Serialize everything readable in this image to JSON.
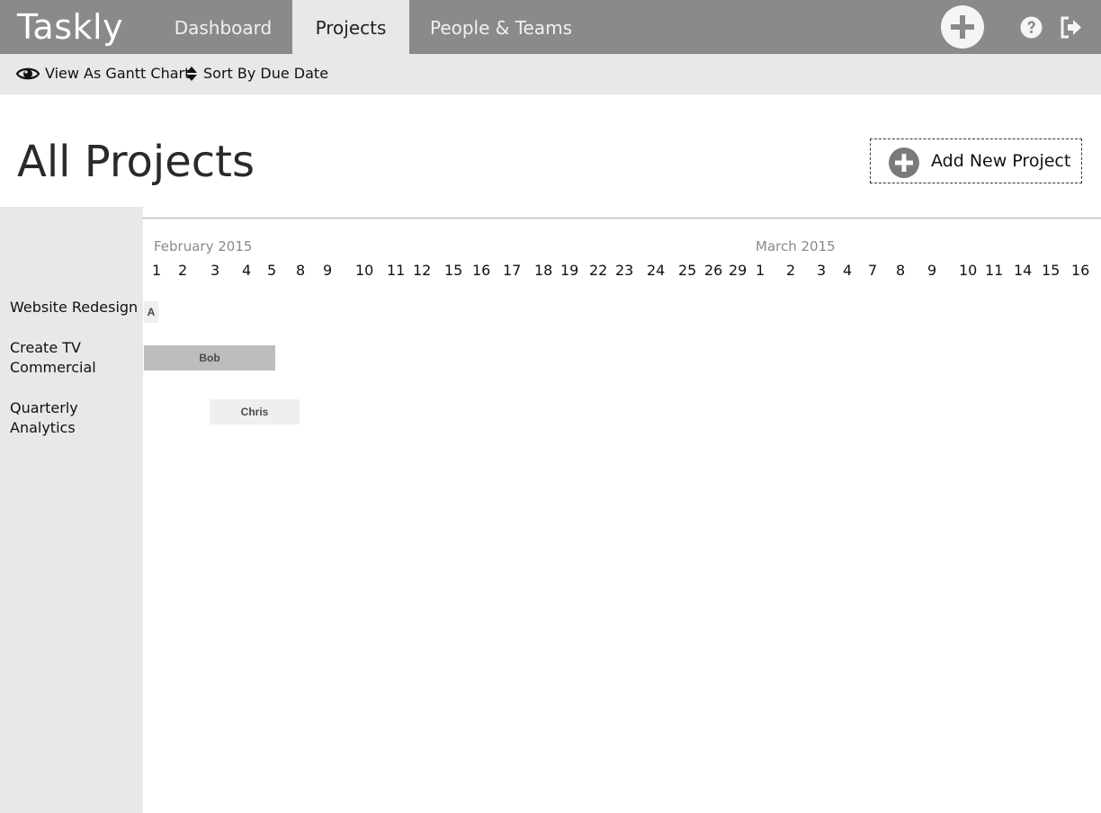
{
  "app": {
    "brand": "Taskly"
  },
  "nav": {
    "tabs": [
      {
        "label": "Dashboard",
        "active": false
      },
      {
        "label": "Projects",
        "active": true
      },
      {
        "label": "People & Teams",
        "active": false
      }
    ]
  },
  "toolbar": {
    "view_label": "View As Gantt Chart",
    "sort_label": "Sort By Due Date"
  },
  "page": {
    "title": "All Projects",
    "add_label": "Add New Project"
  },
  "gantt": {
    "months": [
      "February 2015",
      "March 2015"
    ],
    "days": [
      "1",
      "2",
      "3",
      "4",
      "5",
      "8",
      "9",
      "10",
      "11",
      "12",
      "15",
      "16",
      "17",
      "18",
      "19",
      "22",
      "23",
      "24",
      "25",
      "26",
      "29",
      "1",
      "2",
      "3",
      "4",
      "7",
      "8",
      "9",
      "10",
      "11",
      "14",
      "15",
      "16"
    ],
    "projects": [
      {
        "name": "Website Redesign",
        "assignee": "A"
      },
      {
        "name": "Create TV Commercial",
        "assignee": "Bob"
      },
      {
        "name": "Quarterly Analytics",
        "assignee": "Chris"
      }
    ]
  },
  "colors": {
    "nav_bg": "#8a8a8a",
    "toolbar_bg": "#e8e8e8",
    "bar_dark": "#bdbdbd",
    "bar_light": "#efefef"
  }
}
